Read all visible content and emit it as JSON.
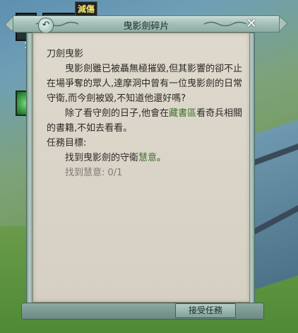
{
  "hud": {
    "status_tag": "減傷",
    "slot_count": "1"
  },
  "dialog": {
    "title": "曳影劍碎片",
    "quest_name": "刀劍曳影",
    "paragraph1_a": "曳影劍雖已被聶無極摧毀,但其影響的卻不止在場爭奪的眾人,達摩洞中曾有一位曳影劍的日常守衛,而今劍被毀,不知道他還好嗎?",
    "paragraph2_a": "除了看守劍的日子,他會在",
    "paragraph2_hl": "藏書區",
    "paragraph2_b": "看奇兵相關的書籍,不如去看看。",
    "goal_heading": "任務目標:",
    "goal_text": "找到曳影劍的守衛",
    "goal_target": "慧意",
    "goal_end": "。",
    "progress": "找到慧意: 0/1",
    "accept_label": "接受任務"
  },
  "colors": {
    "highlight": "#3d6f2a",
    "paper": "#ded9cd",
    "frame": "#9fbcb5"
  }
}
